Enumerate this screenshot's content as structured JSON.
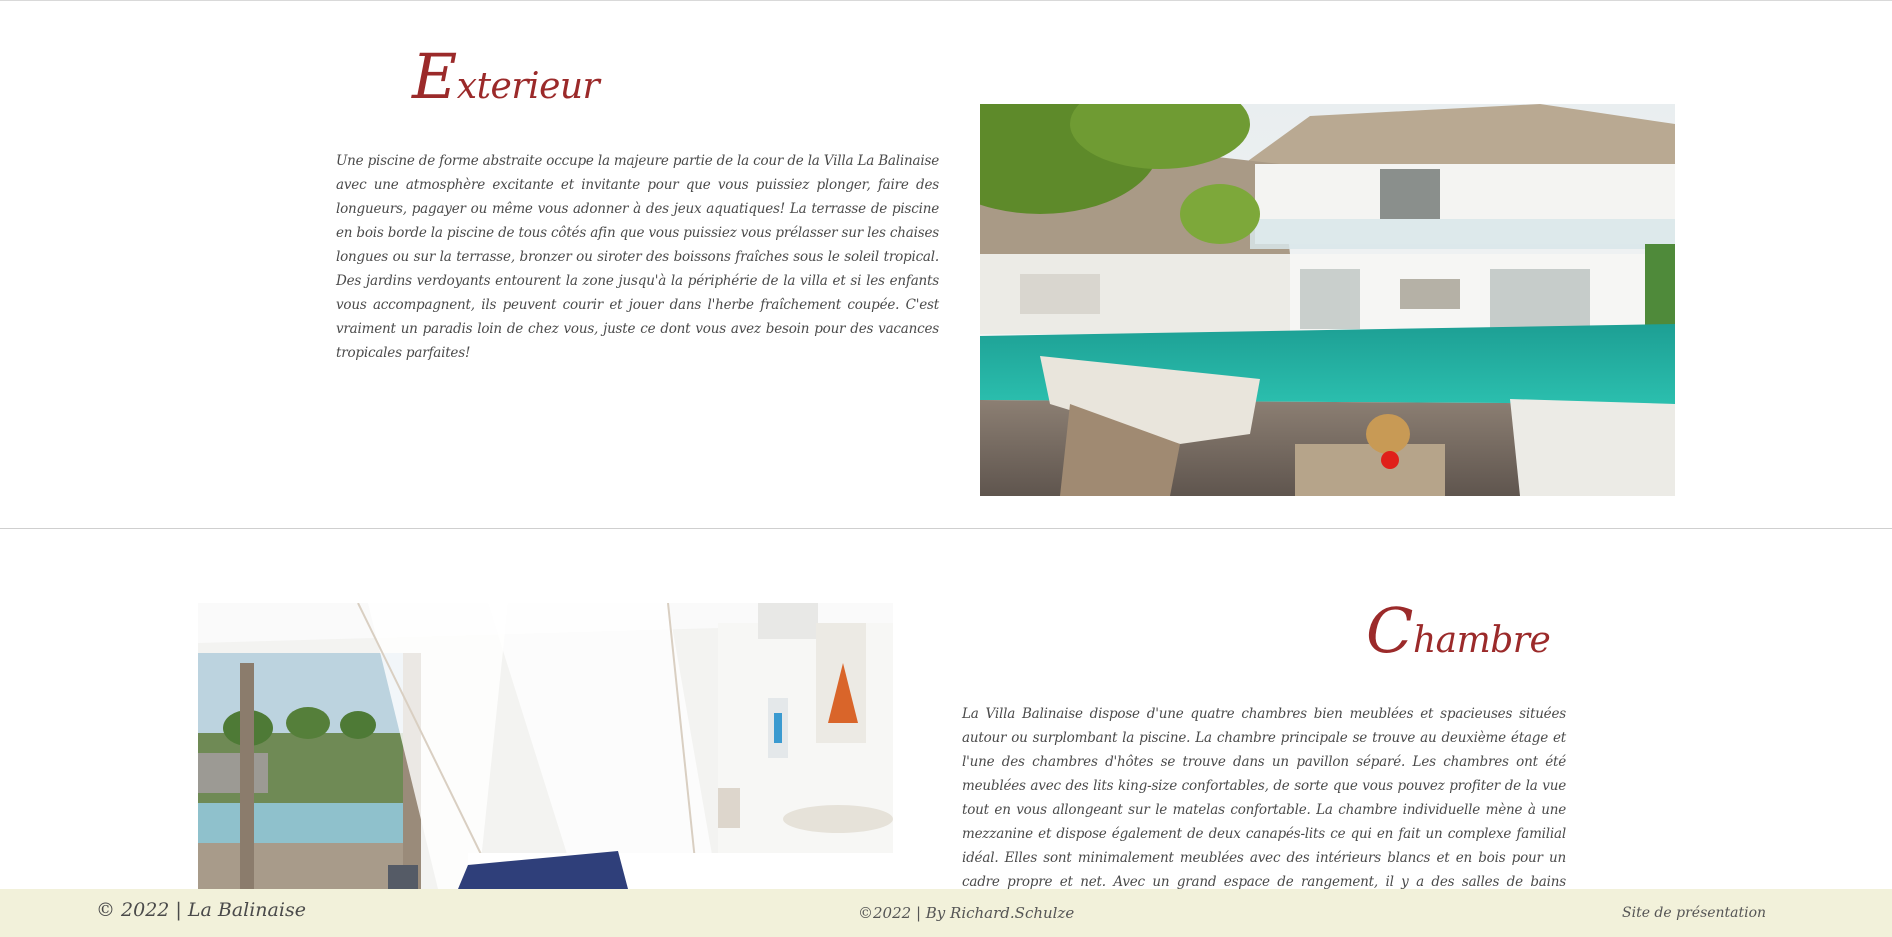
{
  "exterior": {
    "heading_cap": "E",
    "heading_rest": "xterieur",
    "text": "Une piscine de forme abstraite occupe la majeure partie de la cour de la Villa La Balinaise avec une atmosphère excitante et invitante pour que vous puissiez plonger, faire des longueurs, pagayer ou même vous adonner à des jeux aquatiques! La terrasse de piscine en bois borde la piscine de tous côtés afin que vous puissiez vous prélasser sur les chaises longues ou sur la terrasse, bronzer ou siroter des boissons fraîches sous le soleil tropical. Des jardins verdoyants entourent la zone jusqu'à la périphérie de la villa et si les enfants vous accompagnent, ils peuvent courir et jouer dans l'herbe fraîchement coupée. C'est vraiment un paradis loin de chez vous, juste ce dont vous avez besoin pour des vacances tropicales parfaites!"
  },
  "chambre": {
    "heading_cap": "C",
    "heading_rest": "hambre",
    "text": "La Villa Balinaise dispose d'une quatre chambres bien meublées et spacieuses situées autour ou surplombant la piscine. La chambre principale se trouve au deuxième étage et l'une des chambres d'hôtes se trouve dans un pavillon séparé. Les chambres ont été meublées avec des lits king-size confortables, de sorte que vous pouvez profiter de la vue tout en vous allongeant sur le matelas confortable. La chambre individuelle mène à une mezzanine et dispose également de deux canapés-lits ce qui en fait un complexe familial idéal. Elles sont minimalement meublées avec des intérieurs blancs et en bois pour un cadre propre et net. Avec un grand espace de rangement, il y a des salles de bains privatives qui ont des baignoires autoportantes pour les invités!"
  },
  "footer": {
    "left": "© 2022 | La Balinaise",
    "center": "©2022 | By Richard.Schulze",
    "right": "Site de présentation"
  },
  "colors": {
    "heading": "#9b2a2a",
    "footer_bg": "#f2f1da"
  }
}
